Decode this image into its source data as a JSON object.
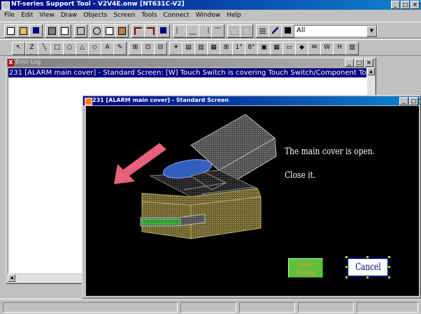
{
  "app": {
    "title": "NT-series Support Tool - V2V4E.onw [NT631C-V2]",
    "window_buttons": [
      "_",
      "□",
      "×"
    ]
  },
  "menu": [
    "File",
    "Edit",
    "View",
    "Draw",
    "Objects",
    "Screen",
    "Tools",
    "Connect",
    "Window",
    "Help"
  ],
  "toolbar1": {
    "layer_select_value": "All"
  },
  "toolbar2": {
    "glyphs": [
      "↖",
      "Z",
      "╲",
      "□",
      "○",
      "△",
      "◇",
      "A",
      "✎",
      "⊞",
      "⊡",
      "⊟",
      "☀",
      "▤",
      "▥",
      "▦",
      "⊞",
      "1°",
      "8°",
      "▣",
      "▦",
      "▭",
      "◆",
      "✉",
      "W",
      "H",
      "▥"
    ]
  },
  "error_log": {
    "title": "Error Log",
    "close_glyph": "X",
    "rows": [
      "231 [ALARM main cover] - Standard Screen: [W] Touch Switch is covering Touch Switch/Component To"
    ]
  },
  "screen_window": {
    "title": "231 [ALARM main cover] - Standard Screen",
    "message_line1": "The main cover is open.",
    "message_line2": "Close it.",
    "alarm_button": [
      "Alarm",
      "history"
    ],
    "cancel_label": "Cancel"
  },
  "colors": {
    "arrow": "#e8607a",
    "box_body": "#8a8040",
    "box_lid": "#6a6a6a",
    "roller": "#3060c0",
    "tray": "#40c040"
  }
}
